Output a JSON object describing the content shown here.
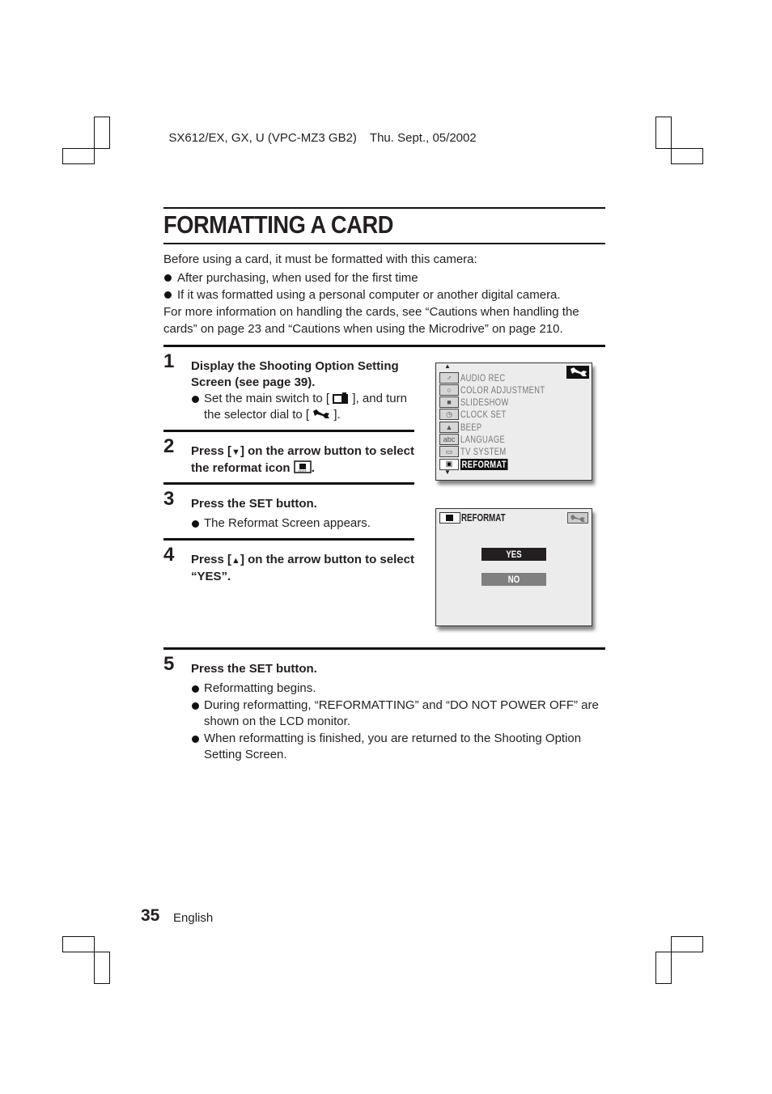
{
  "header": {
    "model": "SX612/EX, GX, U (VPC-MZ3 GB2)",
    "date": "Thu. Sept., 05/2002"
  },
  "page_title": "FORMATTING A CARD",
  "intro": {
    "lead": "Before using a card, it must be formatted with this camera:",
    "bullets": [
      "After purchasing, when used for the first time",
      "If it was formatted using a personal computer or another digital camera."
    ],
    "more_info": "For more information on handling the cards, see “Cautions when handling the cards” on page 23 and “Cautions when using the Microdrive” on page 210."
  },
  "steps": [
    {
      "number": "1",
      "heading": "Display the Shooting Option Setting Screen (see page 39).",
      "bullet_a": "Set the main switch to [",
      "bullet_b": "], and turn the selector dial to [",
      "bullet_c": "]."
    },
    {
      "number": "2",
      "heading_a": "Press [",
      "heading_arrow": "▼",
      "heading_b": "] on the arrow button to select the reformat icon",
      "heading_c": "."
    },
    {
      "number": "3",
      "heading": "Press the SET button.",
      "bullets": [
        "The Reformat Screen appears."
      ]
    },
    {
      "number": "4",
      "heading_a": "Press [",
      "heading_arrow": "▲",
      "heading_b": "] on the arrow button to select “YES”."
    },
    {
      "number": "5",
      "heading": "Press the SET button.",
      "bullets": [
        "Reformatting begins.",
        "During reformatting, “REFORMATTING” and “DO NOT POWER OFF” are shown on the LCD monitor.",
        "When reformatting is finished, you are returned to the Shooting Option Setting Screen."
      ]
    }
  ],
  "lcd_menu": {
    "items": [
      {
        "label": "AUDIO REC",
        "icon": "microphone-icon",
        "glyph": "♂"
      },
      {
        "label": "COLOR ADJUSTMENT",
        "icon": "palette-icon",
        "glyph": "○"
      },
      {
        "label": "SLIDESHOW",
        "icon": "projector-icon",
        "glyph": "■"
      },
      {
        "label": "CLOCK SET",
        "icon": "clock-icon",
        "glyph": "◷"
      },
      {
        "label": "BEEP",
        "icon": "bell-icon",
        "glyph": "▲"
      },
      {
        "label": "LANGUAGE",
        "icon": "abc-icon",
        "glyph": "abc"
      },
      {
        "label": "TV SYSTEM",
        "icon": "tv-icon",
        "glyph": "▭"
      },
      {
        "label": "REFORMAT",
        "icon": "reformat-icon",
        "glyph": "▣",
        "selected": true
      }
    ],
    "mode_icon": "wrench-icon"
  },
  "lcd_reformat": {
    "title": "REFORMAT",
    "yes_label": "YES",
    "no_label": "NO",
    "selected": "YES"
  },
  "footer": {
    "page_number": "35",
    "language": "English"
  }
}
